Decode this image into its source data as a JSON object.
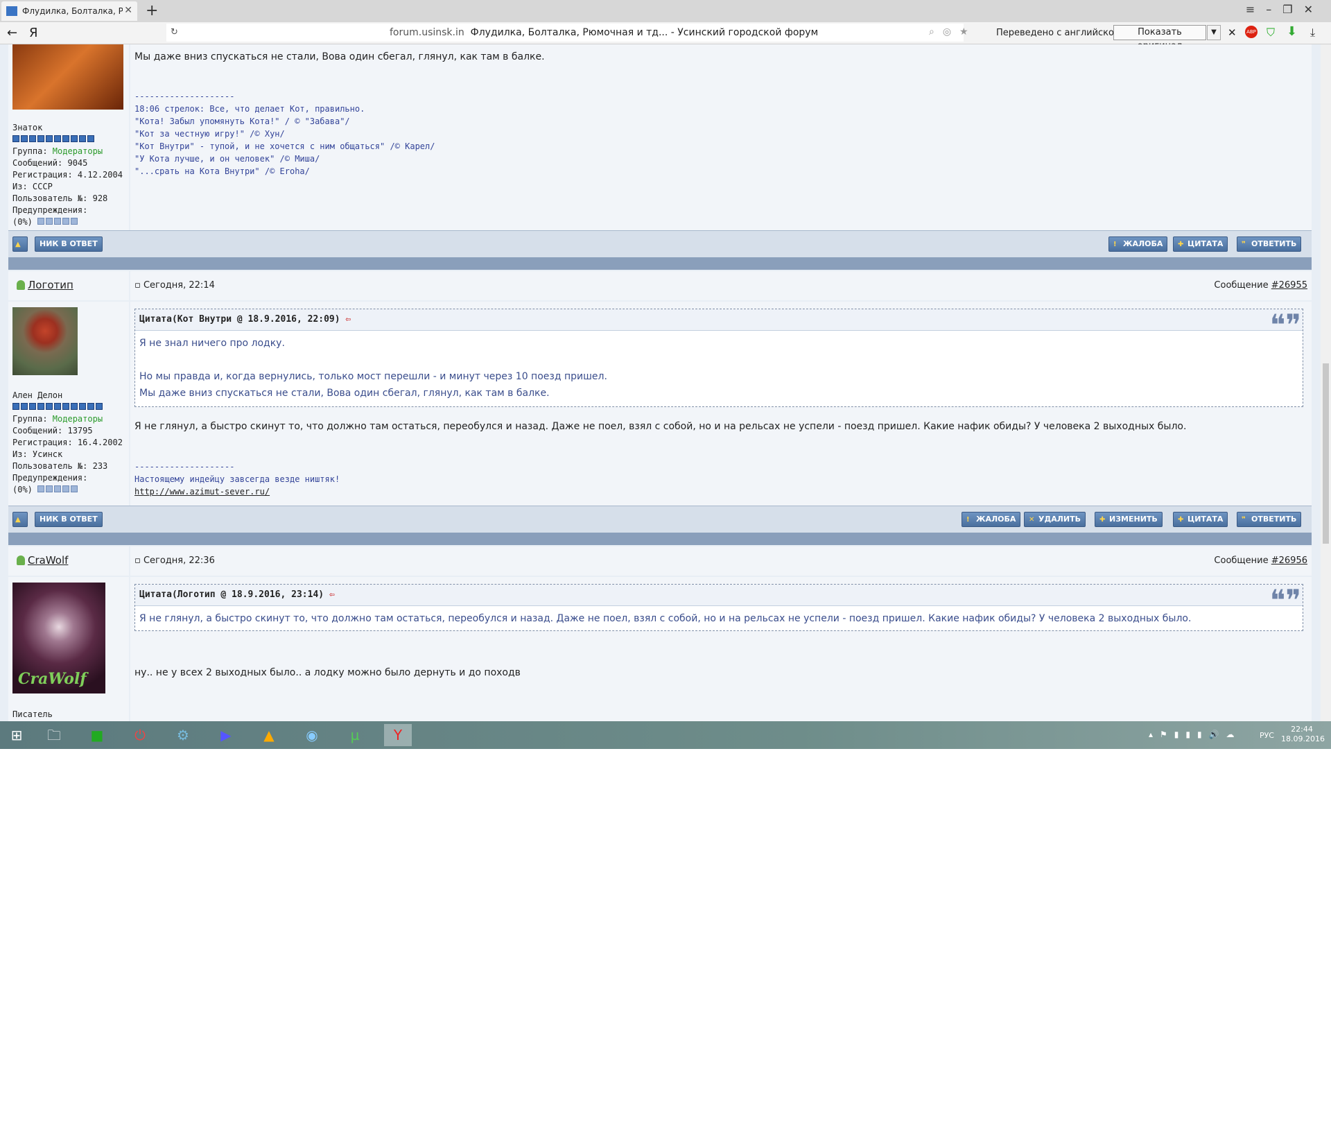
{
  "browser": {
    "tab_title": "Флудилка, Болталка, Рю",
    "address_host": "forum.usinsk.in",
    "address_title": "Флудилка, Болталка, Рюмочная и тд... - Усинский городской форум",
    "translated_label": "Переведено с английского",
    "show_original_label": "Показать оригинал",
    "abp_label": "ABP",
    "icons": [
      "back-icon",
      "yandex-icon",
      "reload-icon",
      "star-icon",
      "close-icon",
      "download-icon"
    ]
  },
  "post1": {
    "text_line": "Мы даже вниз спускаться не стали, Вова один сбегал, глянул, как там в балке.",
    "sig_sep": "--------------------",
    "sig_lines": [
      "18:06 стрелок: Все, что делает Кот, правильно.",
      "\"Кота! Забыл упомянуть Кота!\" / © \"Забава\"/",
      "\"Кот за честную игру!\" /© Хун/",
      "\"Кот Внутри\" - тупой, и не хочется с ним общаться\" /© Карел/",
      "\"У Кота лучше, и он человек\" /© Миша/",
      "\"...срать на Кота Внутри\" /© Eroha/"
    ],
    "user": {
      "rank": "Знаток",
      "group_label": "Группа: ",
      "group": "Модераторы",
      "messages": "Сообщений: 9045",
      "registered": "Регистрация: 4.12.2004",
      "from": "Из: СССР",
      "user_no": "Пользователь №: 928",
      "warnings": "Предупреждения:",
      "warn_pct": "(0%)"
    },
    "buttons": {
      "nick": "НИК В ОТВЕТ",
      "complain": "ЖАЛОБА",
      "quote": "ЦИТАТА",
      "reply": "ОТВЕТИТЬ"
    }
  },
  "post2": {
    "username": "Логотип",
    "date": "Сегодня, 22:14",
    "msg_label": "Сообщение ",
    "msg_no": "#26955",
    "quote_head": "Цитата(Кот Внутри @ 18.9.2016, 22:09)",
    "quote_lines": [
      "Я не знал ничего про лодку.",
      "",
      "Но мы правда и, когда вернулись, только мост перешли - и минут через 10 поезд пришел.",
      "Мы даже вниз спускаться не стали, Вова один сбегал, глянул, как там в балке."
    ],
    "text": "Я не глянул, а быстро скинут то, что должно там остаться, переобулся и назад. Даже не поел, взял с собой, но и на рельсах не успели - поезд пришел. Какие нафик обиды? У человека 2 выходных было.",
    "sig_sep": "--------------------",
    "sig_line": "Настоящему индейцу завсегда везде ништяк!",
    "sig_link": "http://www.azimut-sever.ru/",
    "user": {
      "rank": "Ален Делон",
      "group_label": "Группа: ",
      "group": "Модераторы",
      "messages": "Сообщений: 13795",
      "registered": "Регистрация: 16.4.2002",
      "from": "Из: Усинск",
      "user_no": "Пользователь №: 233",
      "warnings": "Предупреждения:",
      "warn_pct": "(0%)"
    },
    "buttons": {
      "nick": "НИК В ОТВЕТ",
      "complain": "ЖАЛОБА",
      "delete": "УДАЛИТЬ",
      "edit": "ИЗМЕНИТЬ",
      "quote": "ЦИТАТА",
      "reply": "ОТВЕТИТЬ"
    }
  },
  "post3": {
    "username": "CraWolf",
    "date": "Сегодня, 22:36",
    "msg_label": "Сообщение ",
    "msg_no": "#26956",
    "quote_head": "Цитата(Логотип @ 18.9.2016, 23:14)",
    "quote_line": "Я не глянул, а быстро скинут то, что должно там остаться, переобулся и назад. Даже не поел, взял с собой, но и на рельсах не успели - поезд пришел. Какие нафик обиды? У человека 2 выходных было.",
    "text": "ну.. не у всех 2 выходных было.. а лодку можно было дернуть и до походв",
    "avatar_text": "CraWolf",
    "user": {
      "rank": "Писатель"
    }
  },
  "taskbar": {
    "lang": "РУС",
    "time": "22:44",
    "date": "18.09.2016"
  }
}
